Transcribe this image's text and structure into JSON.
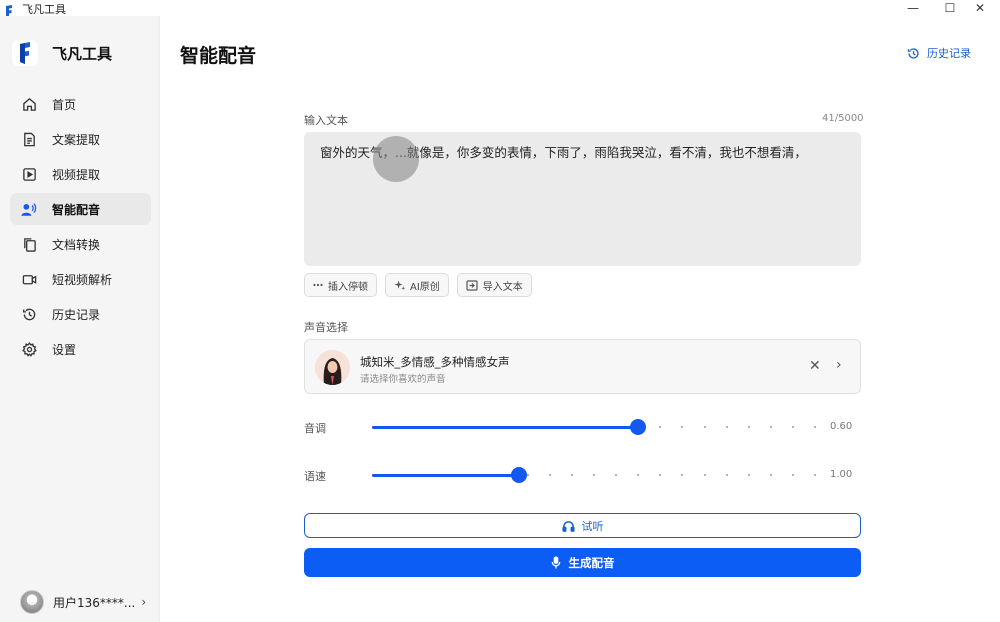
{
  "window": {
    "title": "飞凡工具",
    "controls": {
      "minimize": "—",
      "maximize": "☐",
      "close": "✕"
    }
  },
  "sidebar": {
    "brand": "飞凡工具",
    "items": [
      {
        "label": "首页",
        "icon": "home-icon"
      },
      {
        "label": "文案提取",
        "icon": "document-icon"
      },
      {
        "label": "视频提取",
        "icon": "video-play-icon"
      },
      {
        "label": "智能配音",
        "icon": "voice-user-icon",
        "active": true
      },
      {
        "label": "文档转换",
        "icon": "copy-icon"
      },
      {
        "label": "短视频解析",
        "icon": "camera-icon"
      },
      {
        "label": "历史记录",
        "icon": "history-icon"
      },
      {
        "label": "设置",
        "icon": "gear-icon"
      }
    ],
    "user": {
      "name": "用户136****...",
      "chevron": "›"
    }
  },
  "header": {
    "title": "智能配音",
    "history_link": "历史记录"
  },
  "text_input": {
    "label": "输入文本",
    "counter": "41/5000",
    "value": "窗外的天气，...就像是，你多变的表情，下雨了，雨陷我哭泣，看不清，我也不想看清，"
  },
  "tools": {
    "insert_pause": "插入停顿",
    "ai_original": "AI原创",
    "import_text": "导入文本"
  },
  "voice": {
    "label": "声音选择",
    "name": "城知米_多情感_多种情感女声",
    "hint": "请选择你喜欢的声音",
    "clear": "✕",
    "next": "›"
  },
  "sliders": {
    "pitch": {
      "label": "音调",
      "value": "0.60",
      "fraction": 0.6
    },
    "speed": {
      "label": "语速",
      "value": "1.00",
      "fraction": 0.33
    }
  },
  "actions": {
    "preview": "试听",
    "generate": "生成配音"
  },
  "colors": {
    "accent": "#1557f2",
    "primary_button": "#0c5df5",
    "link": "#1a5fd6",
    "sidebar_bg": "#f5f5f5"
  }
}
